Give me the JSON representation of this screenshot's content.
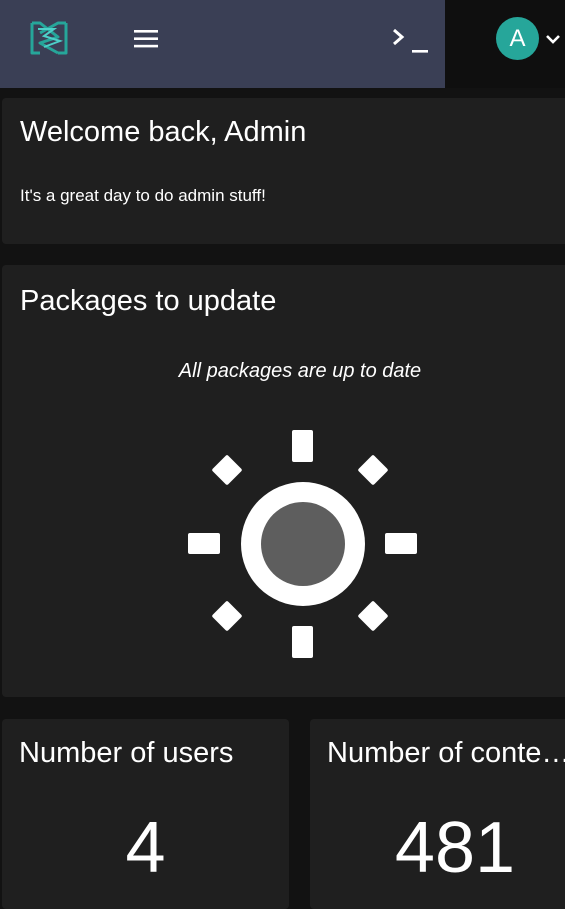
{
  "header": {
    "logo_icon": "hexagon-s-logo-icon",
    "menu_icon": "hamburger-menu-icon",
    "terminal_icon": "terminal-prompt-icon",
    "avatar_initial": "A",
    "avatar_color": "#26a69a",
    "caret_icon": "chevron-down-icon",
    "bar_color": "#3a3f55"
  },
  "welcome": {
    "title": "Welcome back, Admin",
    "subtitle": "It's a great day to do admin stuff!"
  },
  "packages": {
    "title": "Packages to update",
    "message": "All packages are up to date",
    "illustration_icon": "sun-icon"
  },
  "stats": {
    "users": {
      "title": "Number of users",
      "value": "4"
    },
    "content": {
      "title": "Number of contents",
      "value": "481"
    }
  }
}
